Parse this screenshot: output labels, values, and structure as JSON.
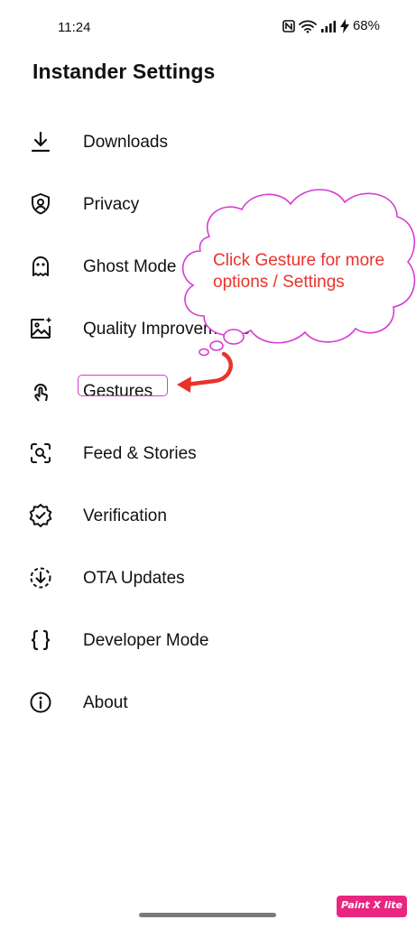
{
  "status_bar": {
    "time": "11:24",
    "battery": "68%"
  },
  "page": {
    "title": "Instander Settings"
  },
  "menu": {
    "items": [
      {
        "label": "Downloads",
        "icon": "download-icon"
      },
      {
        "label": "Privacy",
        "icon": "shield-user-icon"
      },
      {
        "label": "Ghost Mode",
        "icon": "ghost-icon"
      },
      {
        "label": "Quality Improvements",
        "icon": "image-sparkle-icon"
      },
      {
        "label": "Gestures",
        "icon": "touch-gesture-icon"
      },
      {
        "label": "Feed & Stories",
        "icon": "scan-search-icon"
      },
      {
        "label": "Verification",
        "icon": "verified-badge-icon"
      },
      {
        "label": "OTA Updates",
        "icon": "ota-download-icon"
      },
      {
        "label": "Developer Mode",
        "icon": "curly-braces-icon"
      },
      {
        "label": "About",
        "icon": "info-icon"
      }
    ]
  },
  "annotation": {
    "callout_text": "Click Gesture for more options / Settings",
    "callout_color": "#e8332d",
    "outline_color": "#d83bd0",
    "arrow_color": "#e8332d"
  },
  "watermark": {
    "text": "Paint X lite",
    "color": "#e8267f"
  }
}
